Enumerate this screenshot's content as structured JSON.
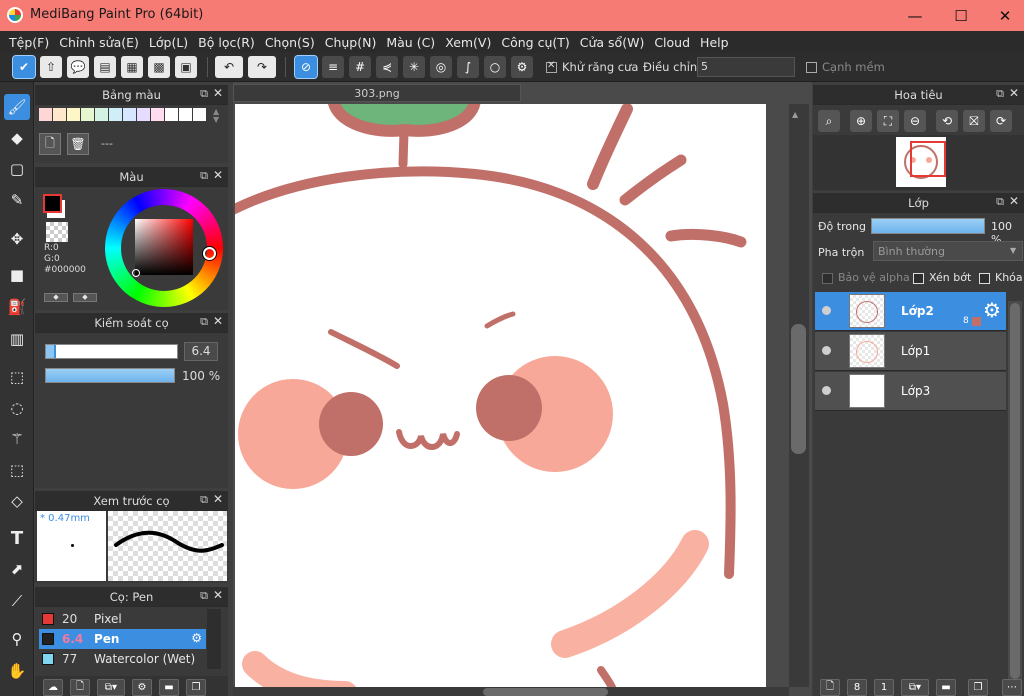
{
  "window": {
    "title": "MediBang Paint Pro (64bit)",
    "minimize": "—",
    "maximize": "☐",
    "close": "✕"
  },
  "menu": [
    "Tệp(F)",
    "Chỉnh sửa(E)",
    "Lớp(L)",
    "Bộ lọc(R)",
    "Chọn(S)",
    "Chụp(N)",
    "Màu (C)",
    "Xem(V)",
    "Công cụ(T)",
    "Cửa sổ(W)",
    "Cloud",
    "Help"
  ],
  "toolbar": {
    "antialias_label": "Khử răng cưa",
    "correction_label": "Điều chỉnh",
    "correction_value": "5",
    "soft_edge_label": "Cạnh mềm"
  },
  "palette_panel": {
    "title": "Bảng màu",
    "dash": "---"
  },
  "color_panel": {
    "title": "Màu",
    "r": "R:0",
    "g": "G:0",
    "hex": "#000000",
    "foreground": "#000000"
  },
  "brush_control": {
    "title": "Kiểm soát cọ",
    "size": "6.4",
    "opacity": "100 %",
    "size_fraction": 0.08,
    "opacity_fraction": 1.0
  },
  "brush_preview": {
    "title": "Xem trước cọ",
    "size_mm": "* 0.47mm"
  },
  "brush_panel": {
    "title": "Cọ: Pen",
    "items": [
      {
        "size": "20",
        "name": "Pixel",
        "color": "#e53935",
        "selected": false
      },
      {
        "size": "6.4",
        "name": "Pen",
        "color": "#222222",
        "selected": true
      },
      {
        "size": "77",
        "name": "Watercolor (Wet)",
        "color": "#7fd6f0",
        "selected": false
      }
    ]
  },
  "document": {
    "tab": "303.png"
  },
  "navigator": {
    "title": "Hoa tiêu"
  },
  "layer_panel": {
    "title": "Lớp",
    "opacity_label": "Độ trong",
    "opacity_value": "100 %",
    "opacity_fraction": 1.0,
    "blend_label": "Pha trộn",
    "blend_value": "Bình thường",
    "protect_alpha": "Bảo vệ alpha",
    "clipping": "Xén bớt",
    "lock": "Khóa",
    "layers": [
      {
        "name": "Lớp2",
        "selected": true,
        "badge": "8"
      },
      {
        "name": "Lớp1",
        "selected": false,
        "badge": ""
      },
      {
        "name": "Lớp3",
        "selected": false,
        "badge": ""
      }
    ]
  },
  "colors": {
    "accent": "#3c8fe0",
    "titlebar": "#f77b75",
    "line": "#c07068",
    "cheek": "#f8a898",
    "eye": "#c07068"
  }
}
